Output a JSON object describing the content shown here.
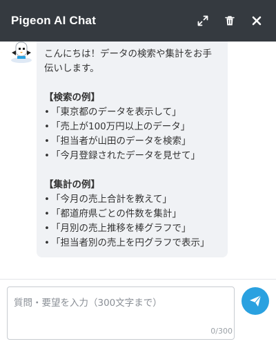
{
  "header": {
    "title": "Pigeon AI Chat",
    "colors": {
      "background": "#353a40",
      "text": "#ffffff"
    },
    "icons": [
      "expand-icon",
      "trash-icon",
      "close-icon"
    ]
  },
  "message": {
    "intro_line1": "こんにちは！データの検索や集計をお手",
    "intro_line2": "伝いします。",
    "search_heading": "【検索の例】",
    "search_examples": [
      "「東京都のデータを表示して」",
      "「売上が100万円以上のデータ」",
      "「担当者が山田のデータを検索」",
      "「今月登録されたデータを見せて」"
    ],
    "aggregate_heading": "【集計の例】",
    "aggregate_examples": [
      "「今月の売上合計を教えて」",
      "「都道府県ごとの件数を集計」",
      "「月別の売上推移を棒グラフで」",
      "「担当者別の売上を円グラフで表示」"
    ]
  },
  "input": {
    "placeholder": "質問・要望を入力（300文字まで）",
    "value": "",
    "counter": "0/300"
  },
  "send": {
    "icon": "paper-plane-icon",
    "color": "#2aa1e0"
  }
}
